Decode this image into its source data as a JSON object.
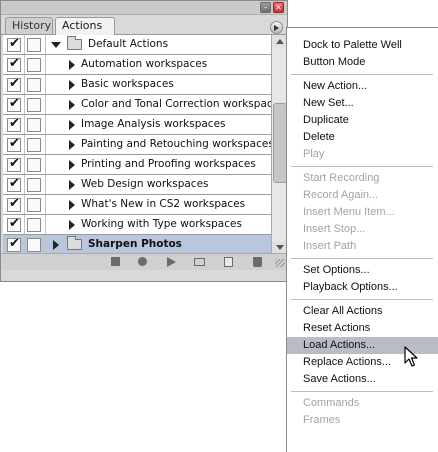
{
  "tabs": {
    "history": "History",
    "actions": "Actions"
  },
  "window_controls": {
    "minimize": "–",
    "close": "✕"
  },
  "rows": [
    {
      "label": "Default Actions",
      "type": "set",
      "expanded": true,
      "checked": true
    },
    {
      "label": "Automation workspaces",
      "type": "action",
      "checked": true
    },
    {
      "label": "Basic workspaces",
      "type": "action",
      "checked": true
    },
    {
      "label": "Color and Tonal Correction workspaces",
      "type": "action",
      "checked": true
    },
    {
      "label": "Image Analysis workspaces",
      "type": "action",
      "checked": true
    },
    {
      "label": "Painting and Retouching workspaces",
      "type": "action",
      "checked": true
    },
    {
      "label": "Printing and Proofing workspaces",
      "type": "action",
      "checked": true
    },
    {
      "label": "Web Design workspaces",
      "type": "action",
      "checked": true
    },
    {
      "label": "What's New in CS2 workspaces",
      "type": "action",
      "checked": true
    },
    {
      "label": "Working with Type workspaces",
      "type": "action",
      "checked": true
    },
    {
      "label": "Sharpen Photos",
      "type": "set",
      "expanded": false,
      "checked": true,
      "selected": true
    }
  ],
  "menu": {
    "items": [
      {
        "label": "Dock to Palette Well",
        "enabled": true
      },
      {
        "label": "Button Mode",
        "enabled": true
      },
      {
        "sep": true
      },
      {
        "label": "New Action...",
        "enabled": true
      },
      {
        "label": "New Set...",
        "enabled": true
      },
      {
        "label": "Duplicate",
        "enabled": true
      },
      {
        "label": "Delete",
        "enabled": true
      },
      {
        "label": "Play",
        "enabled": false
      },
      {
        "sep": true
      },
      {
        "label": "Start Recording",
        "enabled": false
      },
      {
        "label": "Record Again...",
        "enabled": false
      },
      {
        "label": "Insert Menu Item...",
        "enabled": false
      },
      {
        "label": "Insert Stop...",
        "enabled": false
      },
      {
        "label": "Insert Path",
        "enabled": false
      },
      {
        "sep": true
      },
      {
        "label": "Set Options...",
        "enabled": true
      },
      {
        "label": "Playback Options...",
        "enabled": true
      },
      {
        "sep": true
      },
      {
        "label": "Clear All Actions",
        "enabled": true
      },
      {
        "label": "Reset Actions",
        "enabled": true
      },
      {
        "label": "Load Actions...",
        "enabled": true,
        "highlighted": true
      },
      {
        "label": "Replace Actions...",
        "enabled": true
      },
      {
        "label": "Save Actions...",
        "enabled": true
      },
      {
        "sep": true
      },
      {
        "label": "Commands",
        "enabled": false
      },
      {
        "label": "Frames",
        "enabled": false
      }
    ]
  },
  "colors": {
    "selection": "#b8c7dd",
    "menu_highlight": "#b9bcc7",
    "disabled_text": "#a3a3a3"
  }
}
